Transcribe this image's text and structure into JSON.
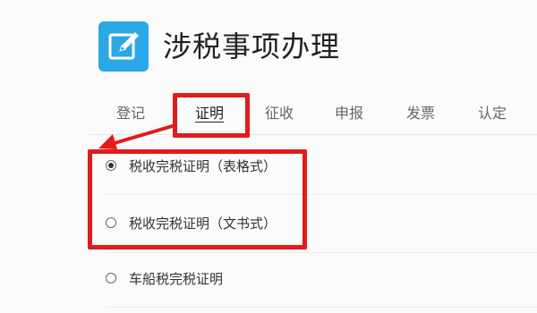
{
  "header": {
    "title": "涉税事项办理",
    "icon": "edit-icon",
    "icon_color": "#2aa8e6"
  },
  "tabs": [
    {
      "label": "登记",
      "active": false
    },
    {
      "label": "证明",
      "active": true
    },
    {
      "label": "征收",
      "active": false
    },
    {
      "label": "申报",
      "active": false
    },
    {
      "label": "发票",
      "active": false
    },
    {
      "label": "认定",
      "active": false
    }
  ],
  "options": [
    {
      "label": "税收完税证明（表格式）",
      "checked": true
    },
    {
      "label": "税收完税证明（文书式）",
      "checked": false
    },
    {
      "label": "车船税完税证明",
      "checked": false
    }
  ],
  "annotation": {
    "color": "#e21b1b"
  }
}
